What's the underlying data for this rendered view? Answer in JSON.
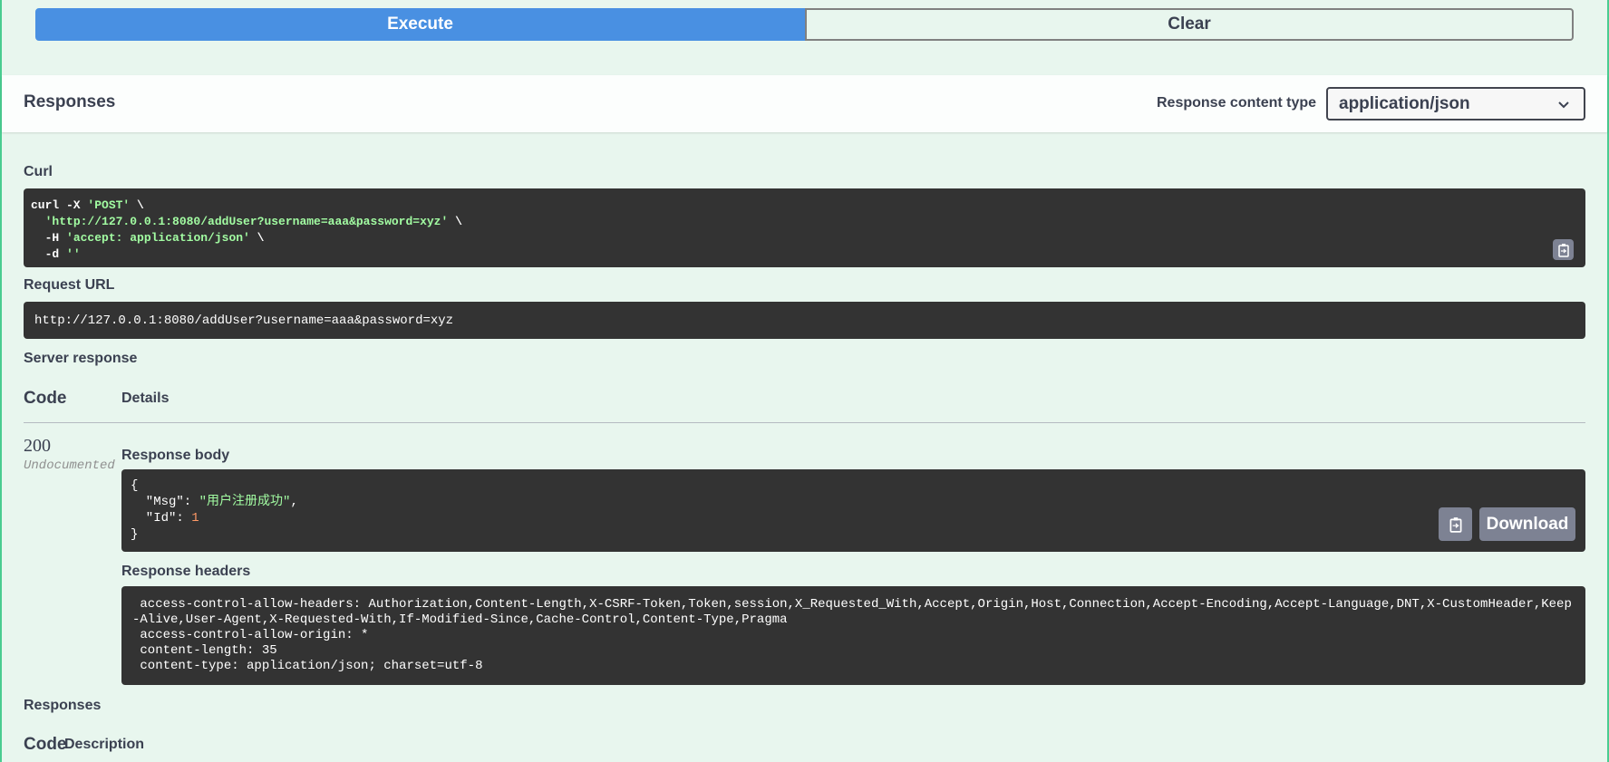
{
  "buttons": {
    "execute": "Execute",
    "clear": "Clear"
  },
  "responses_header": {
    "title": "Responses",
    "content_type_label": "Response content type",
    "content_type_value": "application/json"
  },
  "curl": {
    "label": "Curl",
    "lines": [
      {
        "pre": "curl -X ",
        "str": "'POST'",
        "post": " \\"
      },
      {
        "pre": "  ",
        "str": "'http://127.0.0.1:8080/addUser?username=aaa&password=xyz'",
        "post": " \\"
      },
      {
        "pre": "  -H ",
        "str": "'accept: application/json'",
        "post": " \\"
      },
      {
        "pre": "  -d ",
        "str": "''",
        "post": ""
      }
    ]
  },
  "request_url": {
    "label": "Request URL",
    "value": "http://127.0.0.1:8080/addUser?username=aaa&password=xyz"
  },
  "server_response": {
    "label": "Server response",
    "col_code": "Code",
    "col_details": "Details",
    "code": "200",
    "code_note": "Undocumented",
    "body_label": "Response body",
    "body": {
      "open": "{",
      "msg_key": "  \"Msg\": ",
      "msg_val": "\"用户注册成功\"",
      "msg_comma": ",",
      "id_key": "  \"Id\": ",
      "id_val": "1",
      "close": "}"
    },
    "download_label": "Download",
    "headers_label": "Response headers",
    "headers": [
      " access-control-allow-headers: Authorization,Content-Length,X-CSRF-Token,Token,session,X_Requested_With,Accept,Origin,Host,Connection,Accept-Encoding,Accept-Language,DNT,X-CustomHeader,Keep-Alive,User-Agent,X-Requested-With,If-Modified-Since,Cache-Control,Content-Type,Pragma",
      " access-control-allow-origin: *",
      " content-length: 35",
      " content-type: application/json; charset=utf-8"
    ]
  },
  "responses_section": {
    "label": "Responses",
    "col_code": "Code",
    "col_description": "Description"
  },
  "colors": {
    "background": "#e8f6ee",
    "execute": "#4990e2",
    "code_block": "#333333",
    "string": "#a2fca2",
    "border_accent": "#49cc90"
  },
  "icons": {
    "copy": "clipboard-copy-icon",
    "chevron": "chevron-down-icon"
  }
}
